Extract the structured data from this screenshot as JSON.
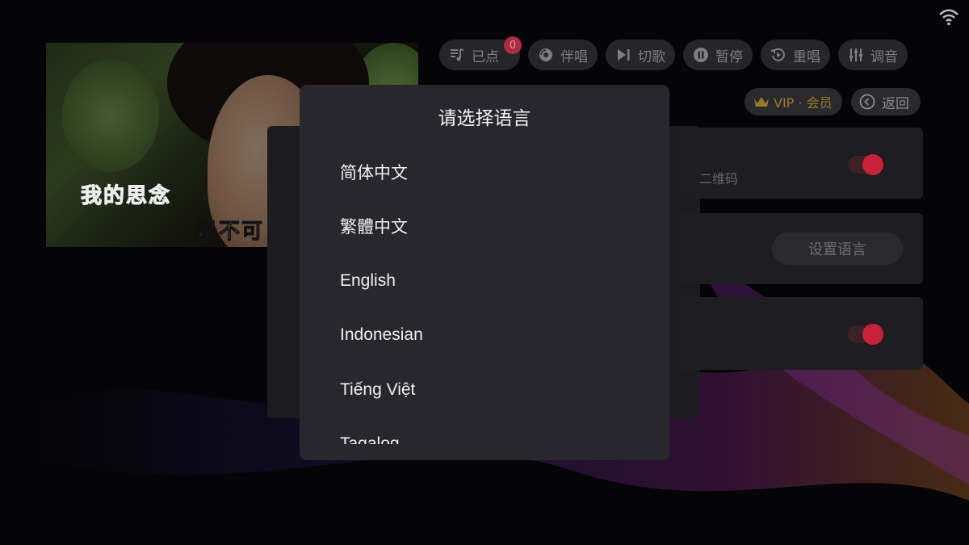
{
  "video": {
    "lyric_line1": "我的思念",
    "lyric_line2": "是不可"
  },
  "toolbar": {
    "buttons": [
      {
        "label": "已点",
        "icon": "playlist-icon",
        "badge": "0"
      },
      {
        "label": "伴唱",
        "icon": "disc-icon"
      },
      {
        "label": "切歌",
        "icon": "skip-icon"
      },
      {
        "label": "暂停",
        "icon": "pause-icon"
      },
      {
        "label": "重唱",
        "icon": "replay-icon"
      },
      {
        "label": "调音",
        "icon": "equalizer-icon"
      }
    ],
    "vip_label": "VIP · 会员",
    "back_label": "返回"
  },
  "settings": {
    "qr_text": "二维码",
    "set_language_button": "设置语言"
  },
  "dialog": {
    "title": "请选择语言",
    "languages": [
      "简体中文",
      "繁體中文",
      "English",
      "Indonesian",
      "Tiếng Việt",
      "Tagalog"
    ]
  },
  "colors": {
    "accent": "#c8223a",
    "dialog_bg": "#27272d",
    "vip": "#9a7a2a"
  }
}
